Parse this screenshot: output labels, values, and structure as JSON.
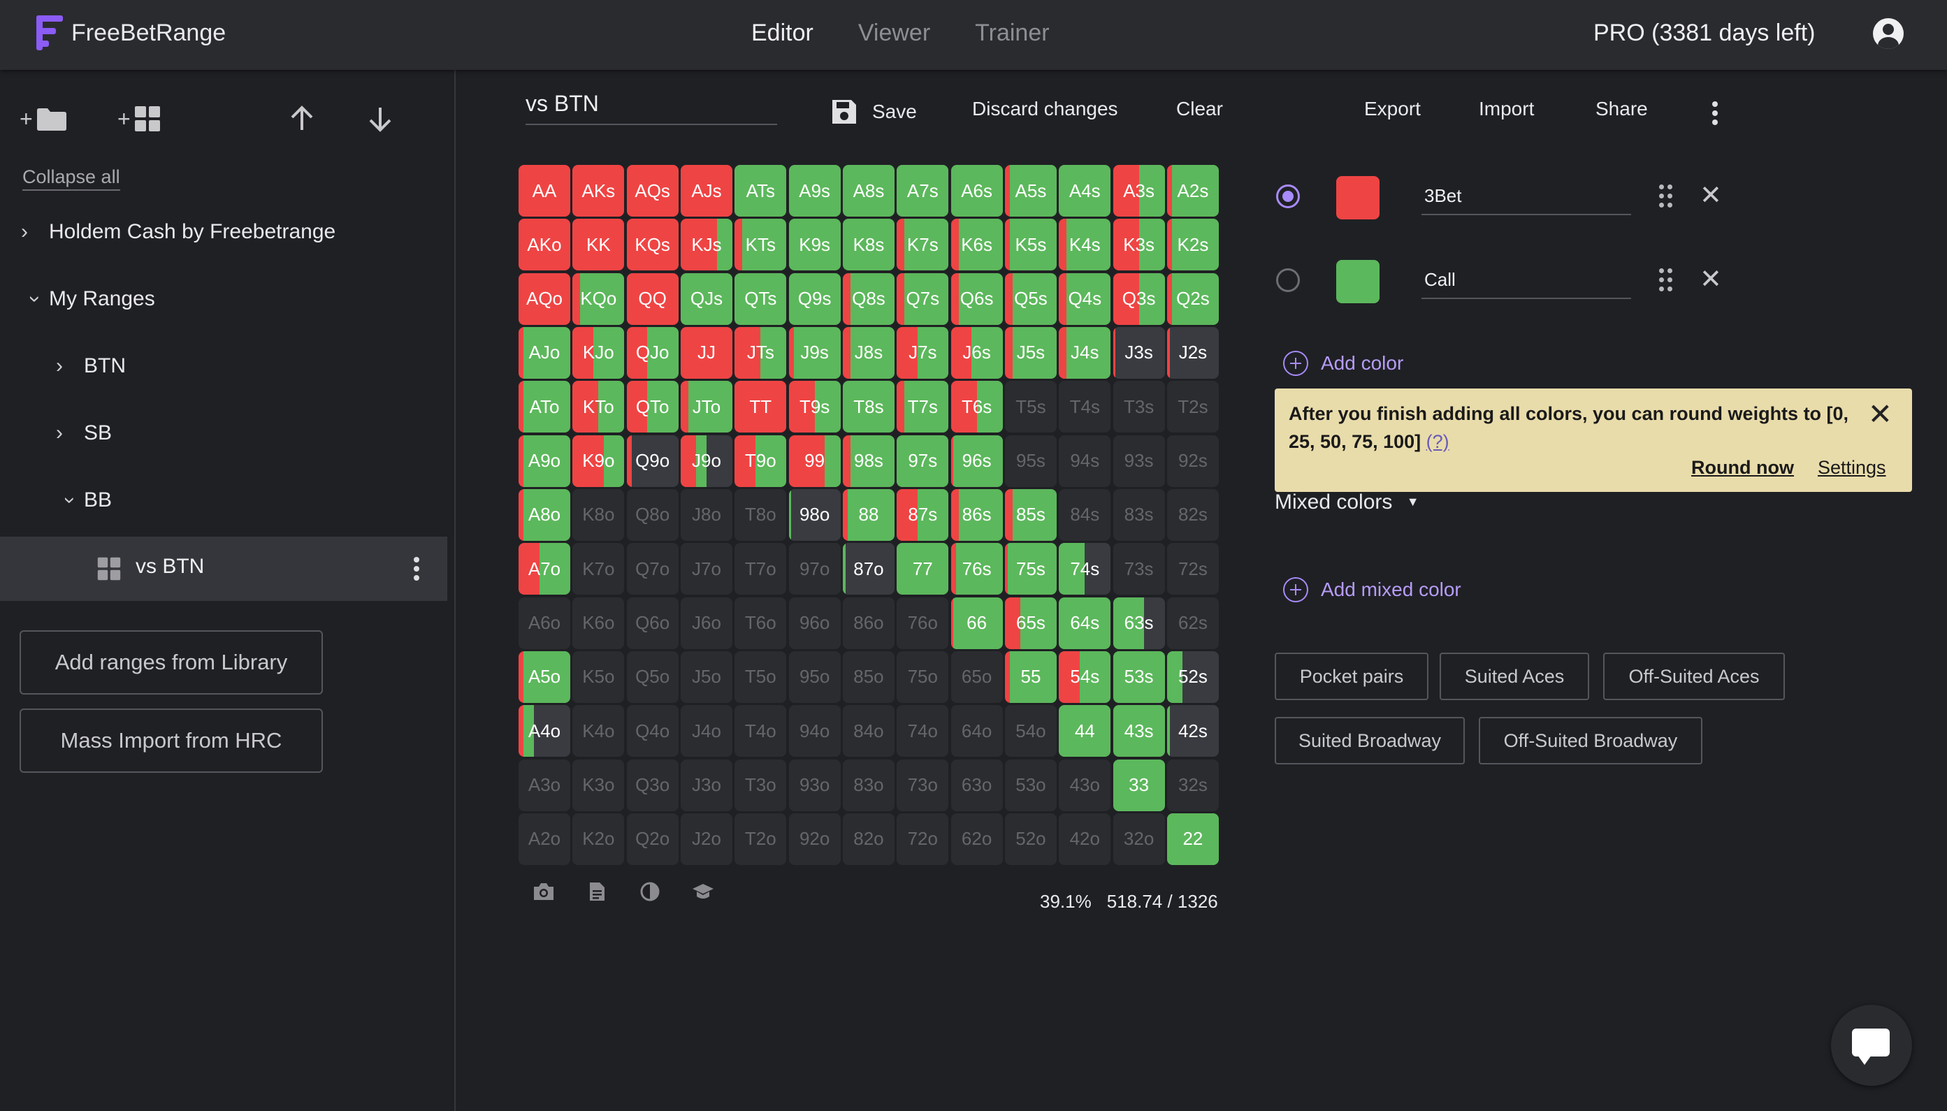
{
  "app": {
    "name": "FreeBetRange",
    "brand_color": "#8b5cf6"
  },
  "nav": {
    "tabs": [
      "Editor",
      "Viewer",
      "Trainer"
    ],
    "active": "Editor"
  },
  "account": {
    "plan": "PRO (3381 days left)",
    "icon": "account-circle-icon"
  },
  "sidebar": {
    "tools": [
      "add-folder",
      "add-range",
      "move-up",
      "move-down"
    ],
    "collapse_all": "Collapse all",
    "tree": [
      {
        "label": "Holdem Cash by Freebetrange",
        "expanded": false
      },
      {
        "label": "My Ranges",
        "expanded": true
      },
      {
        "label": "BTN",
        "expanded": false
      },
      {
        "label": "SB",
        "expanded": false
      },
      {
        "label": "BB",
        "expanded": true
      },
      {
        "label": "vs BTN",
        "selected": true
      }
    ],
    "add_library": "Add ranges from Library",
    "mass_import": "Mass Import from HRC"
  },
  "toolbar": {
    "range_name": "vs BTN",
    "save": "Save",
    "discard": "Discard changes",
    "clear": "Clear",
    "export": "Export",
    "import": "Import",
    "share": "Share"
  },
  "colors": [
    {
      "name": "3Bet",
      "hex": "#ef4444",
      "selected": true
    },
    {
      "name": "Call",
      "hex": "#5cb85c",
      "selected": false
    }
  ],
  "add_color": "Add color",
  "tip": {
    "text": "After you finish adding all colors, you can round weights to [0, 25, 50, 75, 100]",
    "help": "(?)",
    "round_now": "Round now",
    "settings": "Settings"
  },
  "mixed_colors": "Mixed colors",
  "add_mixed_color": "Add mixed color",
  "presets": [
    "Pocket pairs",
    "Suited Aces",
    "Off-Suited Aces",
    "Suited Broadway",
    "Off-Suited Broadway"
  ],
  "stats": {
    "percent": "39.1%",
    "combos": "518.74 / 1326"
  },
  "range_grid": {
    "ranks": [
      "A",
      "K",
      "Q",
      "J",
      "T",
      "9",
      "8",
      "7",
      "6",
      "5",
      "4",
      "3",
      "2"
    ],
    "weights": [
      [
        [
          100,
          0
        ],
        [
          100,
          0
        ],
        [
          100,
          0
        ],
        [
          100,
          0
        ],
        [
          0,
          100
        ],
        [
          0,
          100
        ],
        [
          0,
          100
        ],
        [
          0,
          100
        ],
        [
          0,
          100
        ],
        [
          10,
          90
        ],
        [
          0,
          100
        ],
        [
          50,
          50
        ],
        [
          10,
          90
        ]
      ],
      [
        [
          100,
          0
        ],
        [
          100,
          0
        ],
        [
          100,
          0
        ],
        [
          70,
          30
        ],
        [
          15,
          85
        ],
        [
          0,
          100
        ],
        [
          0,
          100
        ],
        [
          15,
          85
        ],
        [
          15,
          85
        ],
        [
          10,
          90
        ],
        [
          15,
          85
        ],
        [
          50,
          50
        ],
        [
          10,
          90
        ]
      ],
      [
        [
          100,
          0
        ],
        [
          15,
          85
        ],
        [
          100,
          0
        ],
        [
          0,
          100
        ],
        [
          0,
          100
        ],
        [
          0,
          100
        ],
        [
          15,
          85
        ],
        [
          15,
          85
        ],
        [
          15,
          85
        ],
        [
          15,
          85
        ],
        [
          15,
          85
        ],
        [
          50,
          50
        ],
        [
          10,
          90
        ]
      ],
      [
        [
          10,
          90
        ],
        [
          40,
          60
        ],
        [
          40,
          60
        ],
        [
          100,
          0
        ],
        [
          50,
          50
        ],
        [
          10,
          90
        ],
        [
          15,
          85
        ],
        [
          40,
          60
        ],
        [
          40,
          60
        ],
        [
          15,
          85
        ],
        [
          15,
          85
        ],
        [
          5,
          0
        ],
        [
          5,
          0
        ]
      ],
      [
        [
          10,
          90
        ],
        [
          50,
          50
        ],
        [
          40,
          60
        ],
        [
          15,
          85
        ],
        [
          100,
          0
        ],
        [
          50,
          50
        ],
        [
          0,
          100
        ],
        [
          15,
          85
        ],
        [
          50,
          50
        ],
        [
          0,
          0
        ],
        [
          0,
          0
        ],
        [
          0,
          0
        ],
        [
          0,
          0
        ]
      ],
      [
        [
          10,
          90
        ],
        [
          60,
          40
        ],
        [
          10,
          0
        ],
        [
          30,
          20
        ],
        [
          40,
          60
        ],
        [
          70,
          30
        ],
        [
          15,
          85
        ],
        [
          0,
          100
        ],
        [
          5,
          95
        ],
        [
          0,
          0
        ],
        [
          0,
          0
        ],
        [
          0,
          0
        ],
        [
          0,
          0
        ]
      ],
      [
        [
          10,
          90
        ],
        [
          0,
          0
        ],
        [
          0,
          0
        ],
        [
          0,
          0
        ],
        [
          0,
          0
        ],
        [
          0,
          5
        ],
        [
          10,
          90
        ],
        [
          40,
          60
        ],
        [
          15,
          85
        ],
        [
          15,
          85
        ],
        [
          0,
          0
        ],
        [
          0,
          0
        ],
        [
          0,
          0
        ]
      ],
      [
        [
          40,
          60
        ],
        [
          0,
          0
        ],
        [
          0,
          0
        ],
        [
          0,
          0
        ],
        [
          0,
          0
        ],
        [
          0,
          0
        ],
        [
          0,
          5
        ],
        [
          0,
          100
        ],
        [
          10,
          90
        ],
        [
          5,
          95
        ],
        [
          0,
          50
        ],
        [
          0,
          0
        ],
        [
          0,
          0
        ]
      ],
      [
        [
          0,
          0
        ],
        [
          0,
          0
        ],
        [
          0,
          0
        ],
        [
          0,
          0
        ],
        [
          0,
          0
        ],
        [
          0,
          0
        ],
        [
          0,
          0
        ],
        [
          0,
          0
        ],
        [
          5,
          95
        ],
        [
          30,
          70
        ],
        [
          0,
          100
        ],
        [
          0,
          60
        ],
        [
          0,
          0
        ]
      ],
      [
        [
          10,
          90
        ],
        [
          0,
          0
        ],
        [
          0,
          0
        ],
        [
          0,
          0
        ],
        [
          0,
          0
        ],
        [
          0,
          0
        ],
        [
          0,
          0
        ],
        [
          0,
          0
        ],
        [
          0,
          0
        ],
        [
          10,
          90
        ],
        [
          40,
          60
        ],
        [
          0,
          100
        ],
        [
          0,
          30
        ]
      ],
      [
        [
          10,
          20
        ],
        [
          0,
          0
        ],
        [
          0,
          0
        ],
        [
          0,
          0
        ],
        [
          0,
          0
        ],
        [
          0,
          0
        ],
        [
          0,
          0
        ],
        [
          0,
          0
        ],
        [
          0,
          0
        ],
        [
          0,
          0
        ],
        [
          0,
          100
        ],
        [
          0,
          100
        ],
        [
          0,
          5
        ]
      ],
      [
        [
          0,
          0
        ],
        [
          0,
          0
        ],
        [
          0,
          0
        ],
        [
          0,
          0
        ],
        [
          0,
          0
        ],
        [
          0,
          0
        ],
        [
          0,
          0
        ],
        [
          0,
          0
        ],
        [
          0,
          0
        ],
        [
          0,
          0
        ],
        [
          0,
          0
        ],
        [
          0,
          100
        ],
        [
          0,
          0
        ]
      ],
      [
        [
          0,
          0
        ],
        [
          0,
          0
        ],
        [
          0,
          0
        ],
        [
          0,
          0
        ],
        [
          0,
          0
        ],
        [
          0,
          0
        ],
        [
          0,
          0
        ],
        [
          0,
          0
        ],
        [
          0,
          0
        ],
        [
          0,
          0
        ],
        [
          0,
          0
        ],
        [
          0,
          0
        ],
        [
          0,
          100
        ]
      ]
    ]
  }
}
